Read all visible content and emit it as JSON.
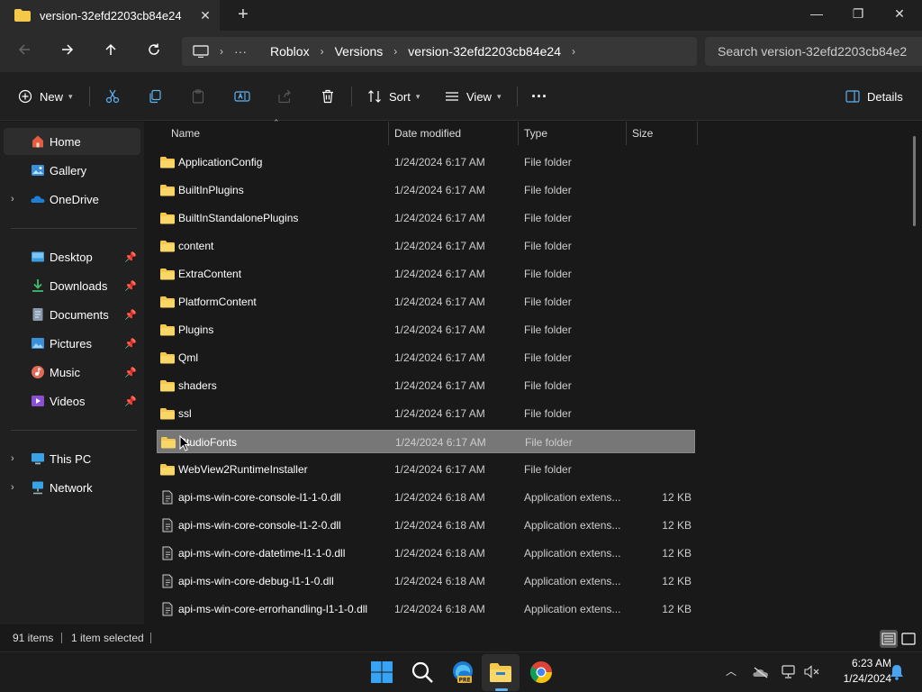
{
  "window": {
    "tab_title": "version-32efd2203cb84e24",
    "tab_close": "✕",
    "new_tab": "+",
    "minimize": "—",
    "maximize": "❐",
    "close": "✕"
  },
  "address": {
    "overflow": "···",
    "crumbs": [
      "Roblox",
      "Versions",
      "version-32efd2203cb84e24"
    ],
    "search_placeholder": "Search version-32efd2203cb84e2"
  },
  "toolbar": {
    "new_label": "New",
    "sort_label": "Sort",
    "view_label": "View",
    "more_label": "···",
    "details_label": "Details"
  },
  "sidebar": {
    "quick": [
      {
        "label": "Home",
        "icon": "home-icon",
        "selected": true
      },
      {
        "label": "Gallery",
        "icon": "gallery-icon"
      },
      {
        "label": "OneDrive",
        "icon": "onedrive-icon",
        "expandable": true
      }
    ],
    "pinned": [
      {
        "label": "Desktop",
        "icon": "desktop-icon"
      },
      {
        "label": "Downloads",
        "icon": "downloads-icon"
      },
      {
        "label": "Documents",
        "icon": "documents-icon"
      },
      {
        "label": "Pictures",
        "icon": "pictures-icon"
      },
      {
        "label": "Music",
        "icon": "music-icon"
      },
      {
        "label": "Videos",
        "icon": "videos-icon"
      }
    ],
    "devices": [
      {
        "label": "This PC",
        "icon": "this-pc-icon"
      },
      {
        "label": "Network",
        "icon": "network-icon"
      }
    ]
  },
  "columns": {
    "name": "Name",
    "date": "Date modified",
    "type": "Type",
    "size": "Size"
  },
  "files": [
    {
      "name": "ApplicationConfig",
      "date": "1/24/2024 6:17 AM",
      "type": "File folder",
      "size": "",
      "kind": "folder"
    },
    {
      "name": "BuiltInPlugins",
      "date": "1/24/2024 6:17 AM",
      "type": "File folder",
      "size": "",
      "kind": "folder"
    },
    {
      "name": "BuiltInStandalonePlugins",
      "date": "1/24/2024 6:17 AM",
      "type": "File folder",
      "size": "",
      "kind": "folder"
    },
    {
      "name": "content",
      "date": "1/24/2024 6:17 AM",
      "type": "File folder",
      "size": "",
      "kind": "folder"
    },
    {
      "name": "ExtraContent",
      "date": "1/24/2024 6:17 AM",
      "type": "File folder",
      "size": "",
      "kind": "folder"
    },
    {
      "name": "PlatformContent",
      "date": "1/24/2024 6:17 AM",
      "type": "File folder",
      "size": "",
      "kind": "folder"
    },
    {
      "name": "Plugins",
      "date": "1/24/2024 6:17 AM",
      "type": "File folder",
      "size": "",
      "kind": "folder"
    },
    {
      "name": "Qml",
      "date": "1/24/2024 6:17 AM",
      "type": "File folder",
      "size": "",
      "kind": "folder"
    },
    {
      "name": "shaders",
      "date": "1/24/2024 6:17 AM",
      "type": "File folder",
      "size": "",
      "kind": "folder"
    },
    {
      "name": "ssl",
      "date": "1/24/2024 6:17 AM",
      "type": "File folder",
      "size": "",
      "kind": "folder"
    },
    {
      "name": "StudioFonts",
      "date": "1/24/2024 6:17 AM",
      "type": "File folder",
      "size": "",
      "kind": "folder",
      "selected": true
    },
    {
      "name": "WebView2RuntimeInstaller",
      "date": "1/24/2024 6:17 AM",
      "type": "File folder",
      "size": "",
      "kind": "folder"
    },
    {
      "name": "api-ms-win-core-console-l1-1-0.dll",
      "date": "1/24/2024 6:18 AM",
      "type": "Application extens...",
      "size": "12 KB",
      "kind": "file"
    },
    {
      "name": "api-ms-win-core-console-l1-2-0.dll",
      "date": "1/24/2024 6:18 AM",
      "type": "Application extens...",
      "size": "12 KB",
      "kind": "file"
    },
    {
      "name": "api-ms-win-core-datetime-l1-1-0.dll",
      "date": "1/24/2024 6:18 AM",
      "type": "Application extens...",
      "size": "12 KB",
      "kind": "file"
    },
    {
      "name": "api-ms-win-core-debug-l1-1-0.dll",
      "date": "1/24/2024 6:18 AM",
      "type": "Application extens...",
      "size": "12 KB",
      "kind": "file"
    },
    {
      "name": "api-ms-win-core-errorhandling-l1-1-0.dll",
      "date": "1/24/2024 6:18 AM",
      "type": "Application extens...",
      "size": "12 KB",
      "kind": "file"
    }
  ],
  "status": {
    "count": "91 items",
    "selection": "1 item selected"
  },
  "taskbar": {
    "time": "6:23 AM",
    "date": "1/24/2024"
  },
  "colors": {
    "accent": "#5fb2f2",
    "folder": "#f4c84a",
    "selection": "#777777"
  }
}
